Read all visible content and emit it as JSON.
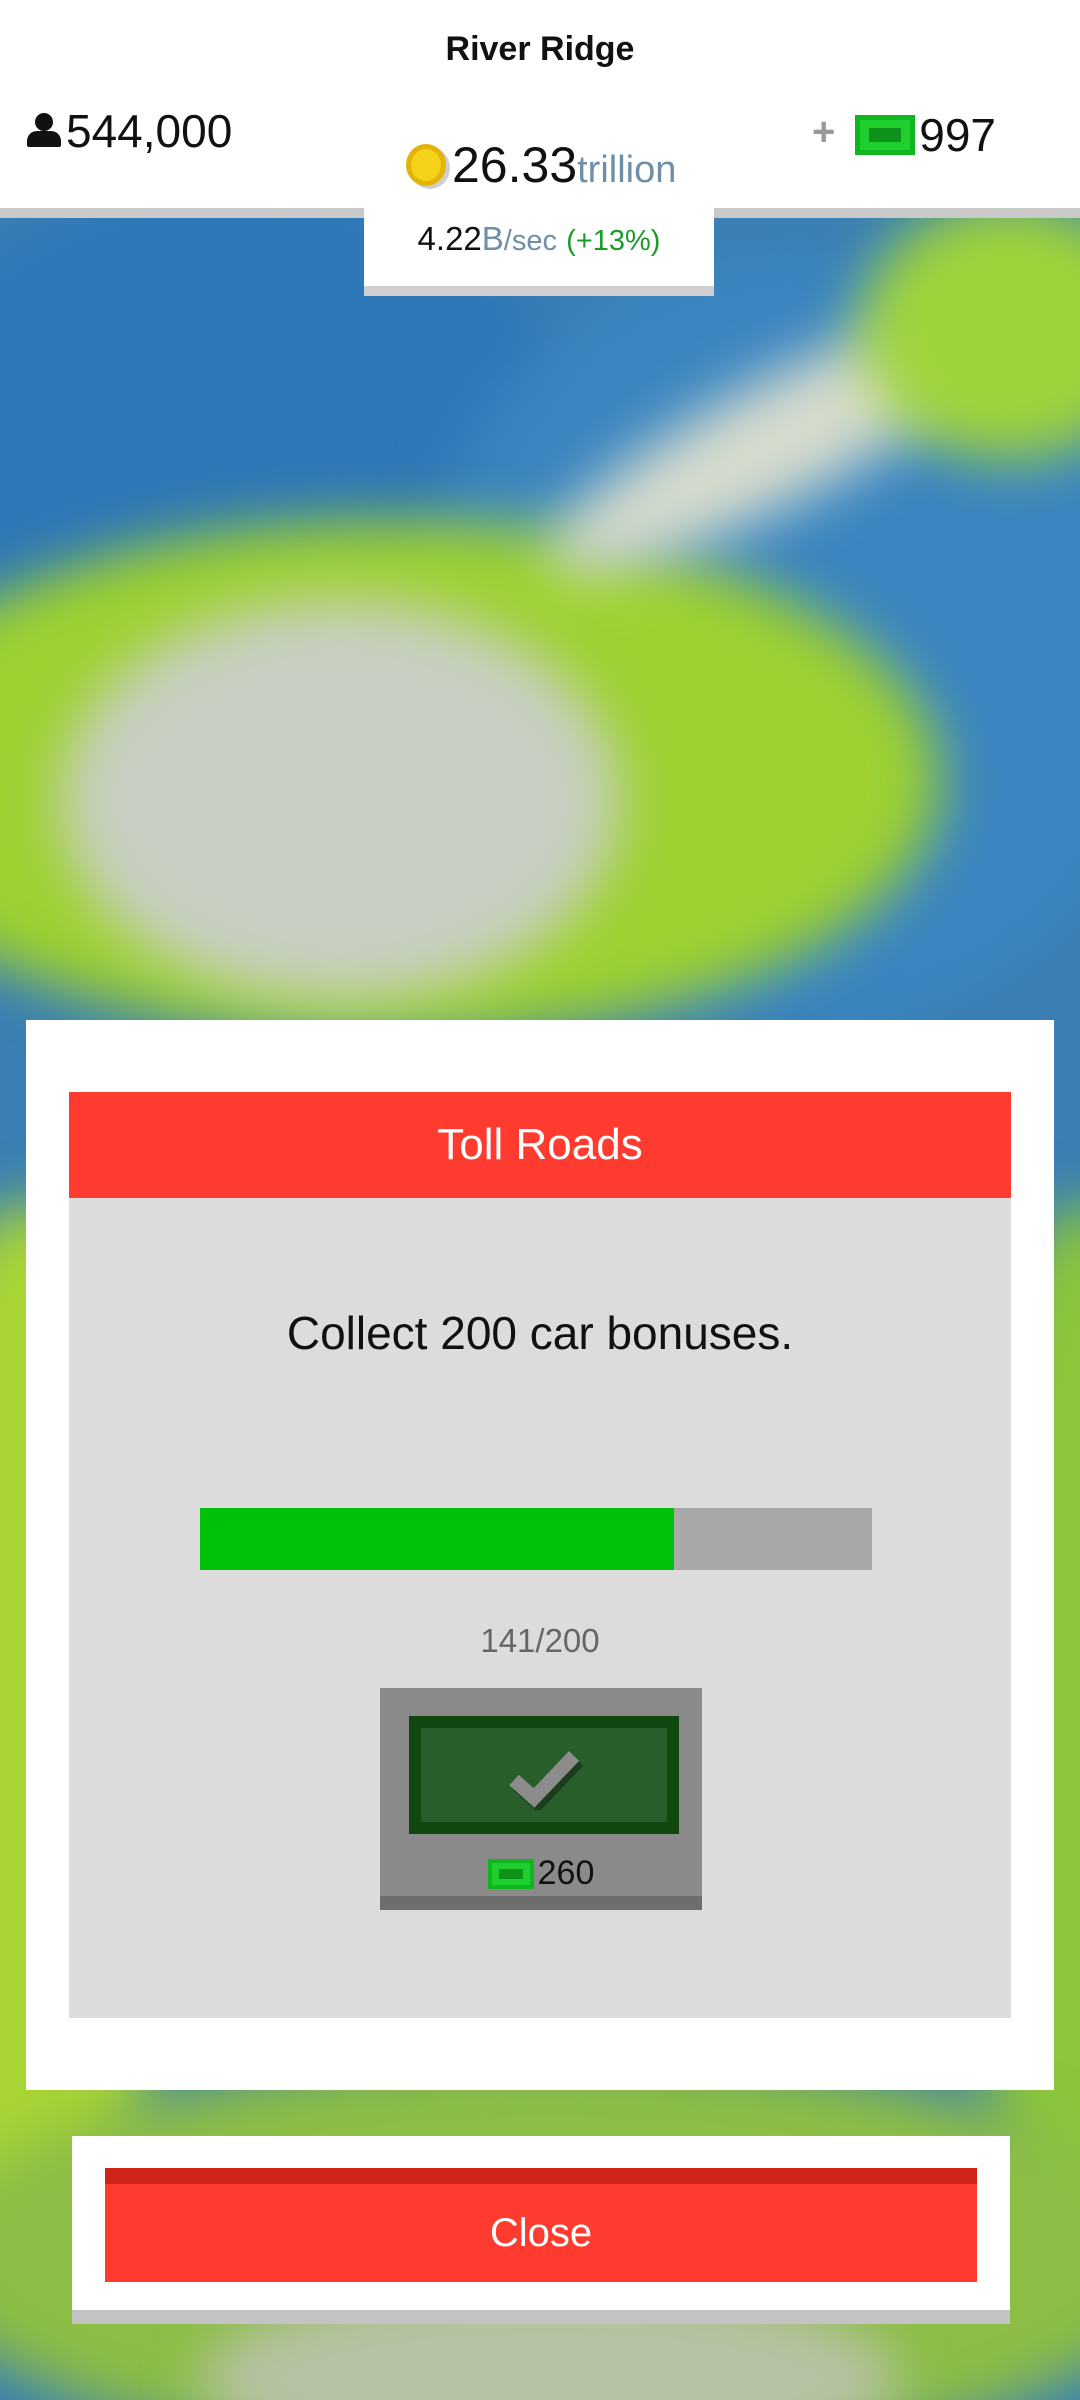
{
  "header": {
    "city_name": "River Ridge",
    "population": "544,000",
    "cash_plus": "+",
    "cash": "997",
    "coins_value": "26.33",
    "coins_unit": "trillion",
    "rate_value": "4.22",
    "rate_unit": "B",
    "rate_per": "/sec",
    "rate_bonus": "(+13%)"
  },
  "modal": {
    "title": "Toll Roads",
    "description": "Collect 200 car bonuses.",
    "progress_current": 141,
    "progress_total": 200,
    "progress_text": "141/200",
    "reward_amount": "260"
  },
  "close_label": "Close",
  "icons": {
    "population": "person-icon",
    "cash": "cash-bill-icon",
    "coins": "coin-icon",
    "claim": "checkmark-icon"
  },
  "colors": {
    "accent_red": "#ff3b2f",
    "progress_green": "#00c10a",
    "cash_green": "#1fcf2e",
    "coin_yellow": "#f4d21a"
  }
}
